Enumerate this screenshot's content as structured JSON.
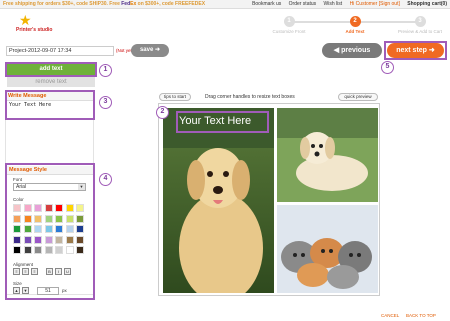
{
  "topbar": {
    "promo_lead": "Free shipping for orders $30+, code SHIP30. Free ",
    "promo_fedex_1": "Fed",
    "promo_fedex_2": "Ex",
    "promo_tail": " on $300+, code FREEFEDEX",
    "links": [
      "Bookmark us",
      "Order status",
      "Wish list"
    ],
    "signin_text": "Hi Customer [Sign out]",
    "cart_label": "Shopping cart(0)"
  },
  "logo": {
    "text": "Printer's studio",
    "icon": "star-icon"
  },
  "steps": [
    {
      "num": "1",
      "label": "Customize Front",
      "active": false
    },
    {
      "num": "2",
      "label": "Add Text",
      "active": true
    },
    {
      "num": "3",
      "label": "Preview & Add to Cart",
      "active": false
    }
  ],
  "project": {
    "name": "Project-2012-09-07 17:34",
    "status": "(Not yet saved)",
    "save_label": "save"
  },
  "nav": {
    "previous_label": "previous",
    "next_label": "next step"
  },
  "left": {
    "add_text_label": "add text",
    "remove_text_label": "remove text",
    "write_message_title": "Write Message",
    "message_value": "Your Text Here",
    "style_title": "Message Style",
    "font_label": "Font",
    "font_value": "Arial",
    "color_label": "Color",
    "alignment_label": "Alignment",
    "size_label": "Size",
    "size_value": "51",
    "size_unit": "px"
  },
  "palette": [
    [
      "#f6c4c8",
      "#f7a7c8",
      "#e8a0d8",
      "#d63f3f",
      "#ff0000",
      "#ffd400",
      "#f4f48b"
    ],
    [
      "#f4a05a",
      "#f58520",
      "#f2c06a",
      "#a0d27f",
      "#8bc34a",
      "#c8e06c",
      "#7a9a3a"
    ],
    [
      "#1b9a3a",
      "#4fa83d",
      "#aed6f1",
      "#7cc7e8",
      "#2b7bd6",
      "#b7d2ec",
      "#1d3d8f"
    ],
    [
      "#3d2a8a",
      "#7a4db8",
      "#9a56c8",
      "#c89ad8",
      "#c2b5a0",
      "#9b7a4a",
      "#6b4a2a"
    ],
    [
      "#000000",
      "#404040",
      "#8a8a8a",
      "#b5b5b5",
      "#d0d0d0",
      "#ffffff",
      "#3a2a1a"
    ]
  ],
  "align_buttons": [
    "left",
    "center",
    "right",
    "bold",
    "italic",
    "underline"
  ],
  "canvas": {
    "tips_label": "tips to start",
    "drag_hint": "Drag corner handles to resize text boxes",
    "quick_preview_label": "quick preview",
    "overlay_text": "Your Text Here"
  },
  "callouts": [
    "1",
    "2",
    "3",
    "4",
    "5"
  ],
  "footer": {
    "cancel": "CANCEL",
    "back_to_top": "BACK TO TOP"
  },
  "colors": {
    "accent": "#f06a22",
    "add_green": "#6fb13a",
    "highlight": "#a05cb8"
  }
}
